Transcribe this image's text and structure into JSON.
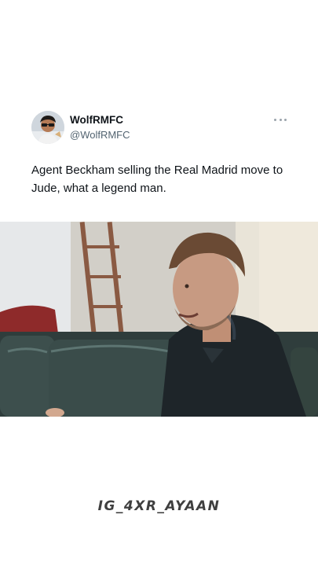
{
  "tweet": {
    "display_name": "WolfRMFC",
    "handle": "@WolfRMFC",
    "text": "Agent Beckham selling the Real Madrid move to Jude, what a legend man.",
    "more_icon": "more-dots-icon",
    "avatar": "profile-avatar"
  },
  "media": {
    "kind": "video-frame",
    "subject": "man seated on dark leather sofa in a bright room"
  },
  "watermark": {
    "text": "IG_4XR_AYAAN"
  }
}
